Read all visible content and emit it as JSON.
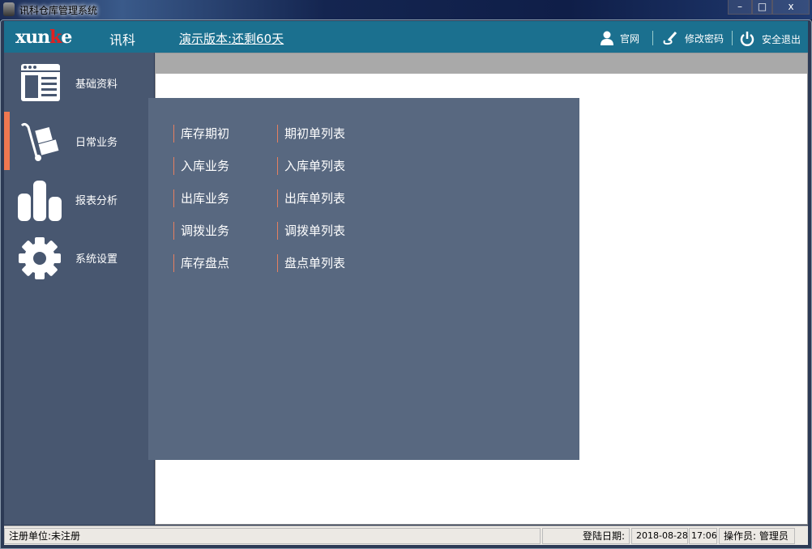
{
  "window": {
    "title": "讯科仓库管理系统",
    "minimize": "–",
    "maximize": "□",
    "close": "x"
  },
  "header": {
    "logo": "xunke",
    "logo_k": "k",
    "logo_pre": "xun",
    "logo_post": "e",
    "logo_cn": "讯科",
    "demo": "演示版本:还剩60天",
    "links": [
      {
        "label": "官网",
        "icon": "user-icon"
      },
      {
        "label": "修改密码",
        "icon": "pen-icon"
      },
      {
        "label": "安全退出",
        "icon": "power-icon"
      }
    ]
  },
  "sidebar": {
    "items": [
      {
        "label": "基础资料",
        "icon": "window-list-icon"
      },
      {
        "label": "日常业务",
        "icon": "hand-truck-icon",
        "active": true
      },
      {
        "label": "报表分析",
        "icon": "bar-chart-icon"
      },
      {
        "label": "系统设置",
        "icon": "gear-icon"
      }
    ]
  },
  "submenu": {
    "col1": [
      "库存期初",
      "入库业务",
      "出库业务",
      "调拨业务",
      "库存盘点"
    ],
    "col2": [
      "期初单列表",
      "入库单列表",
      "出库单列表",
      "调拨单列表",
      "盘点单列表"
    ]
  },
  "status": {
    "company": "注册单位:未注册",
    "login_label": "登陆日期:",
    "date": "2018-08-28",
    "time": "17:06",
    "operator": "操作员: 管理员"
  },
  "colors": {
    "header": "#1b708f",
    "sidebar": "#485770",
    "popup": "#586880",
    "accent": "#f07850"
  }
}
